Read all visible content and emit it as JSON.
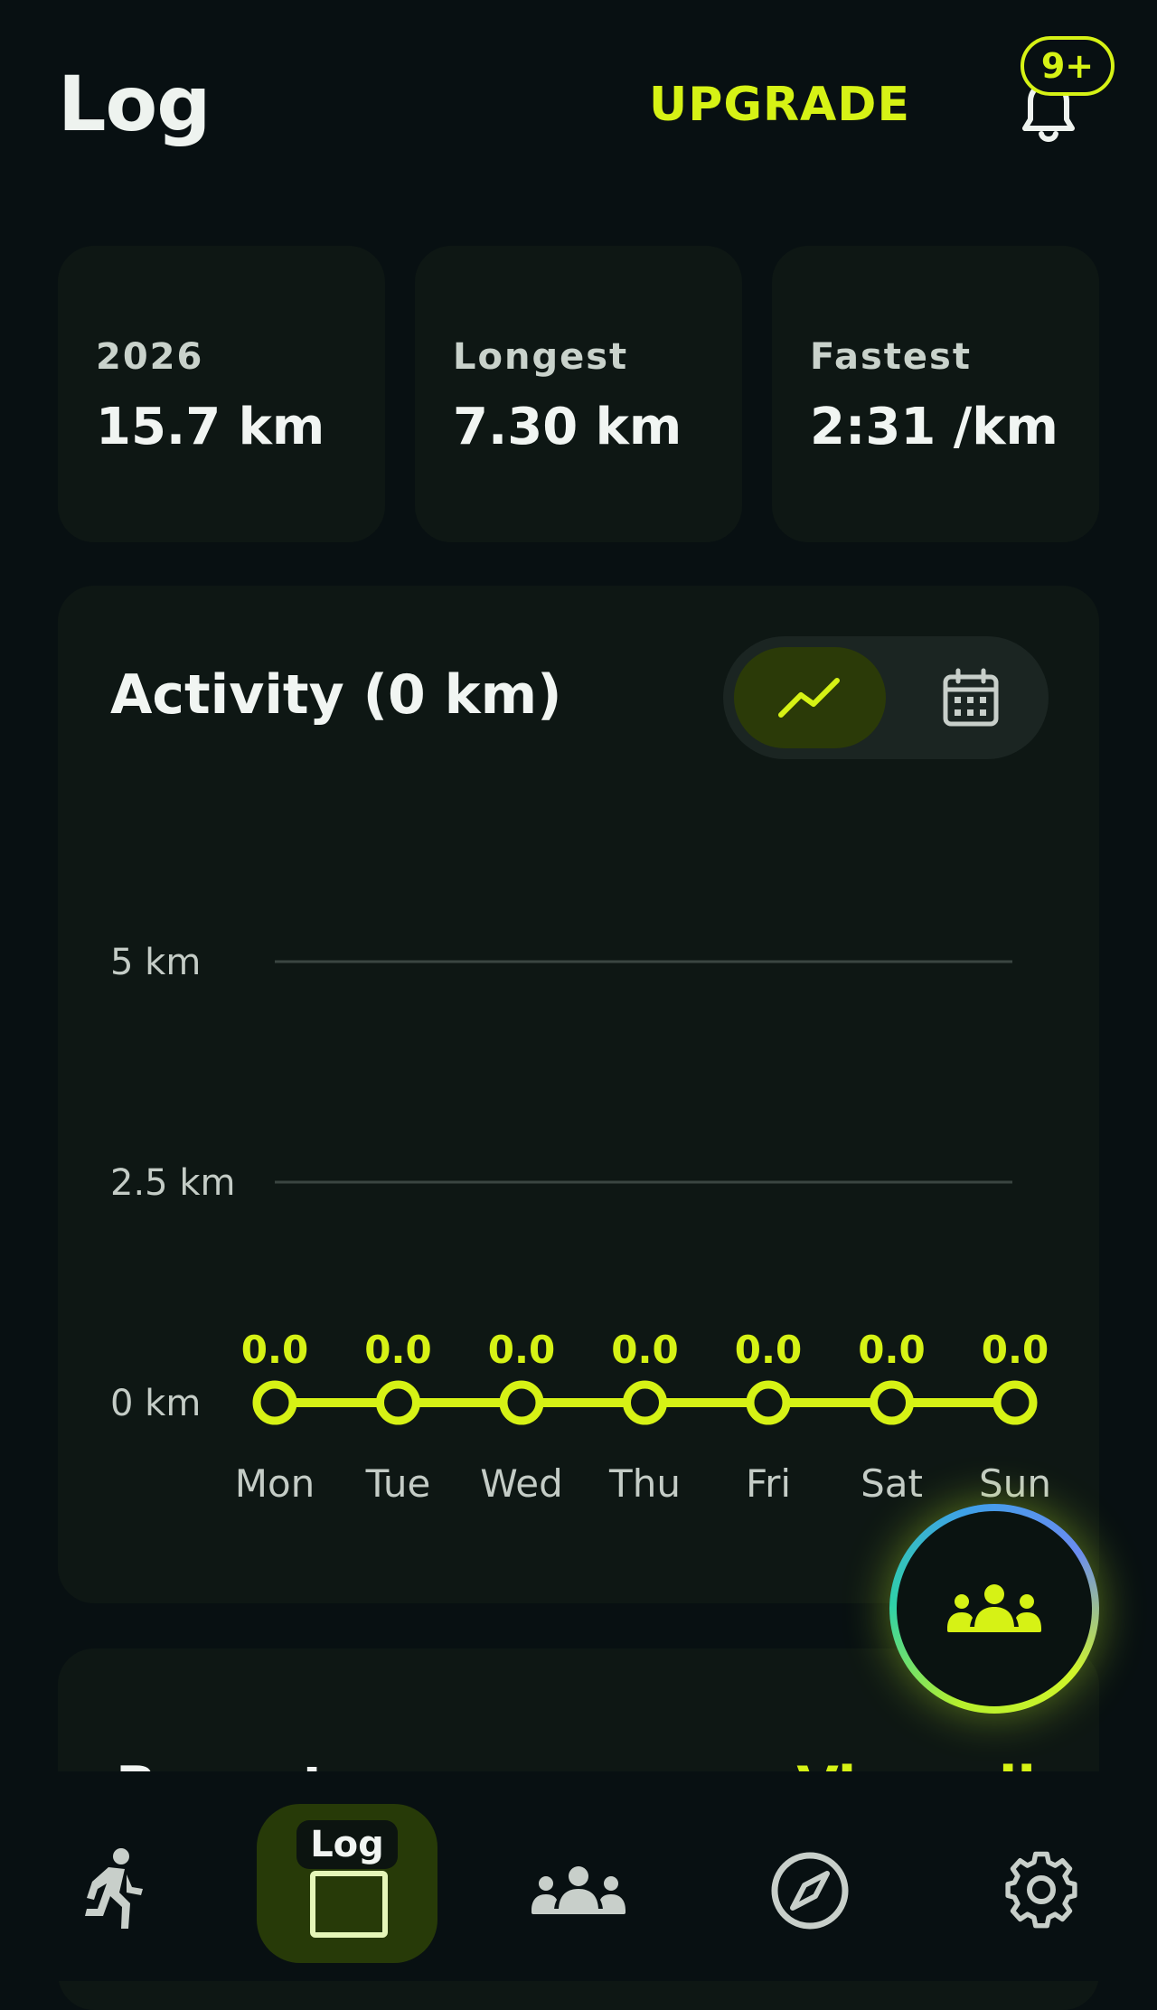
{
  "header": {
    "title": "Log",
    "upgrade_label": "UPGRADE",
    "notification_badge": "9+"
  },
  "stats": [
    {
      "label": "2026",
      "value": "15.7 km"
    },
    {
      "label": "Longest",
      "value": "7.30 km"
    },
    {
      "label": "Fastest",
      "value": "2:31 /km"
    }
  ],
  "activity": {
    "title": "Activity (0 km)",
    "view_toggle": {
      "selected": "line-chart",
      "options": [
        "line-chart-icon",
        "calendar-icon"
      ]
    }
  },
  "recent": {
    "title": "Recent",
    "link": "View all"
  },
  "nav": {
    "active_label": "Log",
    "items": [
      "run-icon",
      "log",
      "group-icon",
      "compass-icon",
      "gear-icon"
    ]
  },
  "colors": {
    "accent": "#d6f215",
    "background": "#081012",
    "card": "#0e1714"
  },
  "chart_data": {
    "type": "line",
    "categories": [
      "Mon",
      "Tue",
      "Wed",
      "Thu",
      "Fri",
      "Sat",
      "Sun"
    ],
    "series": [
      {
        "values": [
          0.0,
          0.0,
          0.0,
          0.0,
          0.0,
          0.0,
          0.0
        ]
      }
    ],
    "data_labels": [
      "0.0",
      "0.0",
      "0.0",
      "0.0",
      "0.0",
      "0.0",
      "0.0"
    ],
    "yticks": [
      0,
      2.5,
      5
    ],
    "ytick_labels": [
      "0 km",
      "2.5 km",
      "5 km"
    ],
    "ylim": [
      0,
      5
    ],
    "grid": true
  }
}
